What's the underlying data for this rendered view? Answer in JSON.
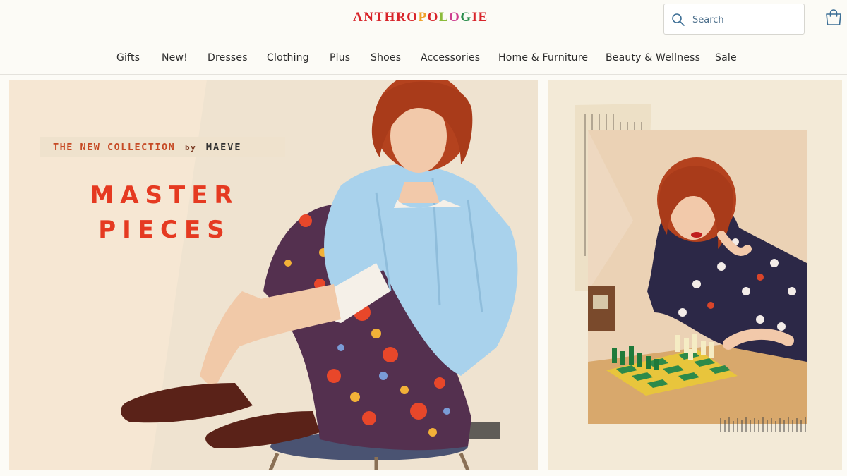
{
  "brand": {
    "name": "ANTHROPOLOGIE",
    "letter_colors": [
      "#d8242a",
      "#d8242a",
      "#d8242a",
      "#d8242a",
      "#d8242a",
      "#d8242a",
      "#f0a12a",
      "#d8242a",
      "#8bbb3a",
      "#cd3d8f",
      "#2a8d4c",
      "#d8242a",
      "#d8242a"
    ]
  },
  "search": {
    "placeholder": "Search"
  },
  "nav": {
    "items": [
      "Gifts",
      "New!",
      "Dresses",
      "Clothing",
      "Plus",
      "Shoes",
      "Accessories",
      "Home & Furniture",
      "Beauty & Wellness",
      "Sale"
    ]
  },
  "hero": {
    "tagline": {
      "prefix": "THE NEW COLLECTION",
      "by": "by",
      "brand": "MAEVE"
    },
    "headline": [
      "MASTER",
      "PIECES"
    ],
    "accent_color": "#e53a21"
  },
  "icons": {
    "search": "search-icon",
    "bag": "shopping-bag-icon"
  }
}
